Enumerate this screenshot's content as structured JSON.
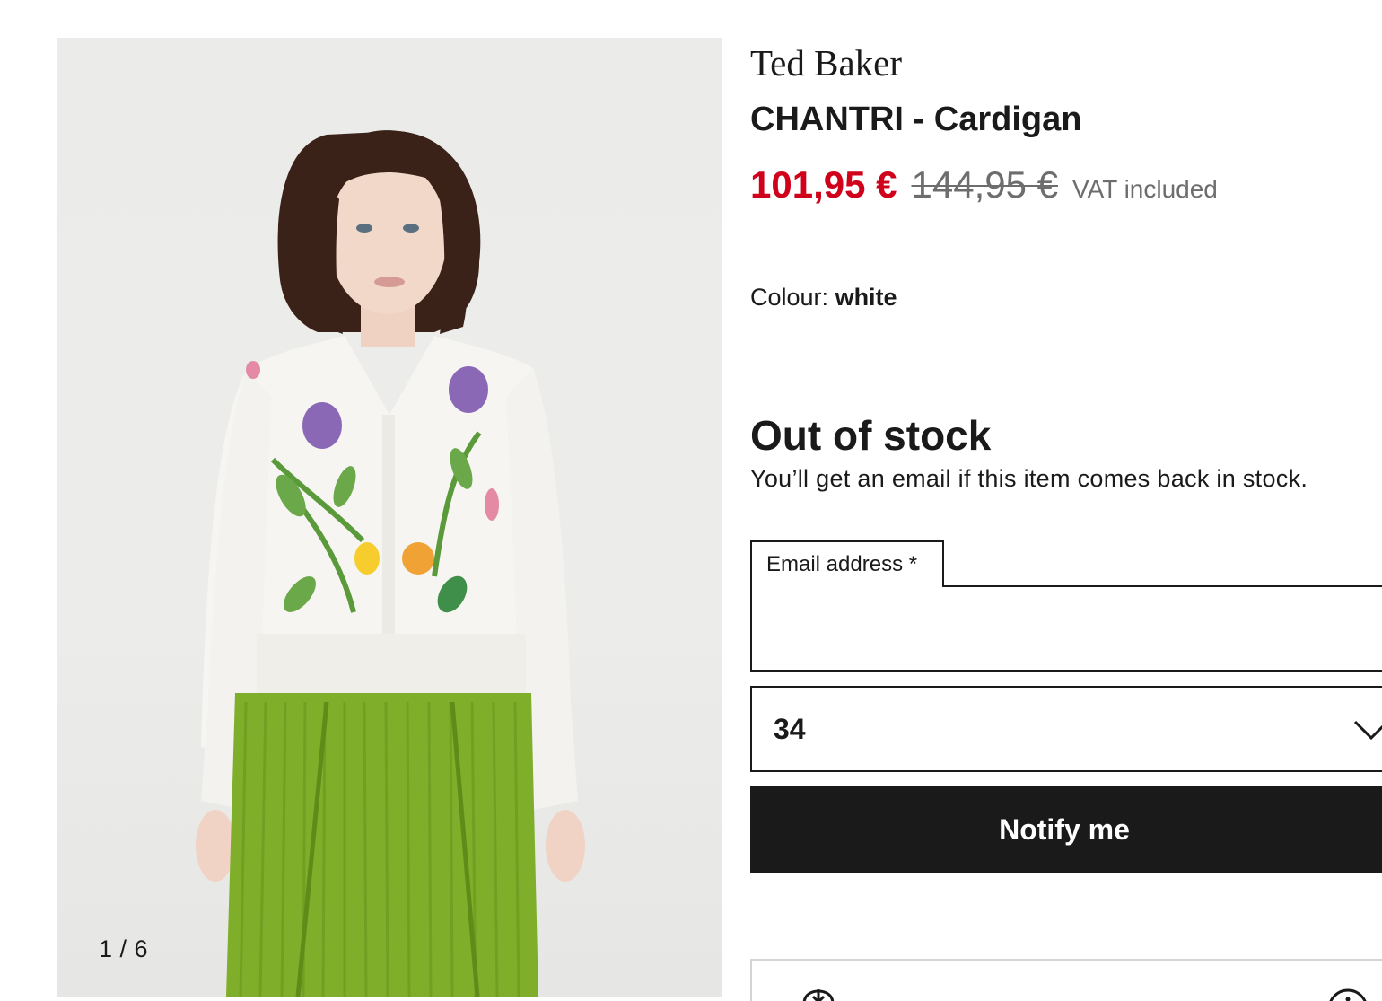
{
  "product": {
    "brand": "Ted Baker",
    "name": "CHANTRI - Cardigan",
    "price_current": "101,95 €",
    "price_original": "144,95 €",
    "vat_note": "VAT included",
    "colour_label": "Colour:",
    "colour_value": "white"
  },
  "gallery": {
    "counter": "1 / 6",
    "image_icon": "product-photo"
  },
  "stock": {
    "heading": "Out of stock",
    "message": "You’ll get an email if this item comes back in stock."
  },
  "form": {
    "email_label": "Email address *",
    "email_value": "",
    "size_selected": "34",
    "notify_label": "Notify me"
  },
  "icons": {
    "select": "chevron-down-icon",
    "delivery": "delivery-icon",
    "info": "info-icon"
  },
  "colors": {
    "sale_price": "#d0021b",
    "muted_text": "#6d6d6d",
    "primary_button": "#1a1a1a",
    "button_text": "#ffffff"
  }
}
